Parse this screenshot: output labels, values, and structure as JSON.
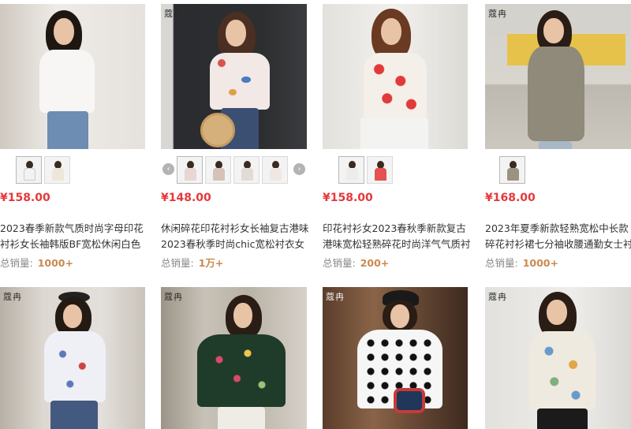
{
  "brand_mark": "蔻冉",
  "products": [
    {
      "price": "¥158.00",
      "title_line1": "2023春季新款气质时尚字母印花",
      "title_line2": "衬衫女长袖韩版BF宽松休闲白色",
      "sales_label": "总销量:",
      "sales_value": "1000+",
      "colors": {
        "bg": "#e9e6e1",
        "shirt": "#f5f4f2"
      }
    },
    {
      "price": "¥148.00",
      "title_line1": "休闲碎花印花衬衫女长袖复古港味",
      "title_line2": "2023春秋季时尚chic宽松衬衣女",
      "sales_label": "总销量:",
      "sales_value": "1万+",
      "colors": {
        "bg": "#2c2e30",
        "shirt": "#f1e6e4"
      }
    },
    {
      "price": "¥158.00",
      "title_line1": "印花衬衫女2023春秋季新款复古",
      "title_line2": "港味宽松轻熟碎花时尚洋气气质衬",
      "sales_label": "总销量:",
      "sales_value": "200+",
      "colors": {
        "bg": "#ecebe8",
        "shirt": "#e03b3b"
      }
    },
    {
      "price": "¥168.00",
      "title_line1": "2023年夏季新款轻熟宽松中长款",
      "title_line2": "碎花衬衫裙七分袖收腰通勤女士衬",
      "sales_label": "总销量:",
      "sales_value": "1000+",
      "colors": {
        "bg": "#dcd6cf",
        "shirt": "#8f8a79"
      }
    }
  ],
  "row2_colors": [
    {
      "bg": "#d8d2ca",
      "shirt": "#eef0f6"
    },
    {
      "bg": "#b9b2a6",
      "shirt": "#1f3b2a"
    },
    {
      "bg": "#6b4b36",
      "shirt": "#f6f6f6"
    },
    {
      "bg": "#e8e7e3",
      "shirt": "#efeae0"
    }
  ],
  "carousel": {
    "prev_icon": "‹",
    "next_icon": "›"
  }
}
